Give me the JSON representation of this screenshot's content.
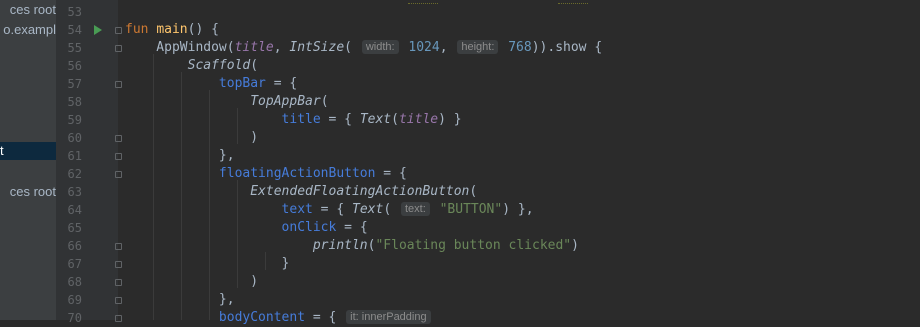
{
  "sidebar": {
    "items": [
      {
        "label": "ces root"
      },
      {
        "label": "o.exampl"
      },
      {
        "label": "t"
      },
      {
        "label": "ces root"
      }
    ]
  },
  "gutter": {
    "line_numbers": [
      "53",
      "54",
      "55",
      "56",
      "57",
      "58",
      "59",
      "60",
      "61",
      "62",
      "63",
      "64",
      "65",
      "66",
      "67",
      "68",
      "69",
      "70"
    ]
  },
  "code": {
    "lines": [
      [],
      [
        {
          "t": "fun ",
          "c": "kw"
        },
        {
          "t": "main",
          "c": "fn"
        },
        {
          "t": "() {"
        }
      ],
      [
        {
          "t": "    AppWindow("
        },
        {
          "t": "title",
          "c": "param"
        },
        {
          "t": ", "
        },
        {
          "t": "IntSize",
          "c": "it"
        },
        {
          "t": "( "
        },
        {
          "h": "width:"
        },
        {
          "t": " 1024",
          "c": "num"
        },
        {
          "t": ", "
        },
        {
          "h": "height:"
        },
        {
          "t": " 768",
          "c": "num"
        },
        {
          "t": ")).show {"
        }
      ],
      [
        {
          "t": "        "
        },
        {
          "t": "Scaffold",
          "c": "it"
        },
        {
          "t": "("
        }
      ],
      [
        {
          "t": "            "
        },
        {
          "t": "topBar",
          "c": "named"
        },
        {
          "t": " = {"
        }
      ],
      [
        {
          "t": "                "
        },
        {
          "t": "TopAppBar",
          "c": "it"
        },
        {
          "t": "("
        }
      ],
      [
        {
          "t": "                    "
        },
        {
          "t": "title",
          "c": "named"
        },
        {
          "t": " = { "
        },
        {
          "t": "Text",
          "c": "it"
        },
        {
          "t": "("
        },
        {
          "t": "title",
          "c": "param"
        },
        {
          "t": ") }"
        }
      ],
      [
        {
          "t": "                )"
        }
      ],
      [
        {
          "t": "            },"
        }
      ],
      [
        {
          "t": "            "
        },
        {
          "t": "floatingActionButton",
          "c": "named"
        },
        {
          "t": " = {"
        }
      ],
      [
        {
          "t": "                "
        },
        {
          "t": "ExtendedFloatingActionButton",
          "c": "it"
        },
        {
          "t": "("
        }
      ],
      [
        {
          "t": "                    "
        },
        {
          "t": "text",
          "c": "named"
        },
        {
          "t": " = { "
        },
        {
          "t": "Text",
          "c": "it"
        },
        {
          "t": "( "
        },
        {
          "h": "text:"
        },
        {
          "t": " \"BUTTON\"",
          "c": "str"
        },
        {
          "t": ") },"
        }
      ],
      [
        {
          "t": "                    "
        },
        {
          "t": "onClick",
          "c": "named"
        },
        {
          "t": " = {"
        }
      ],
      [
        {
          "t": "                        "
        },
        {
          "t": "println",
          "c": "it"
        },
        {
          "t": "("
        },
        {
          "t": "\"Floating button clicked\"",
          "c": "str"
        },
        {
          "t": ")"
        }
      ],
      [
        {
          "t": "                    }"
        }
      ],
      [
        {
          "t": "                )"
        }
      ],
      [
        {
          "t": "            },"
        }
      ],
      [
        {
          "t": "            "
        },
        {
          "t": "bodyContent",
          "c": "named"
        },
        {
          "t": " = { "
        },
        {
          "h": "it: innerPadding"
        }
      ]
    ]
  },
  "colors": {
    "background": "#2b2b2b",
    "keyword": "#cc7832",
    "function": "#ffc66d",
    "number": "#6897bb",
    "string": "#6a8759",
    "named_argument": "#467cda",
    "parameter": "#9876aa",
    "run_marker": "#499c54"
  },
  "icons": {
    "run": "run-gutter-icon",
    "fold": "fold-marker-icon"
  }
}
